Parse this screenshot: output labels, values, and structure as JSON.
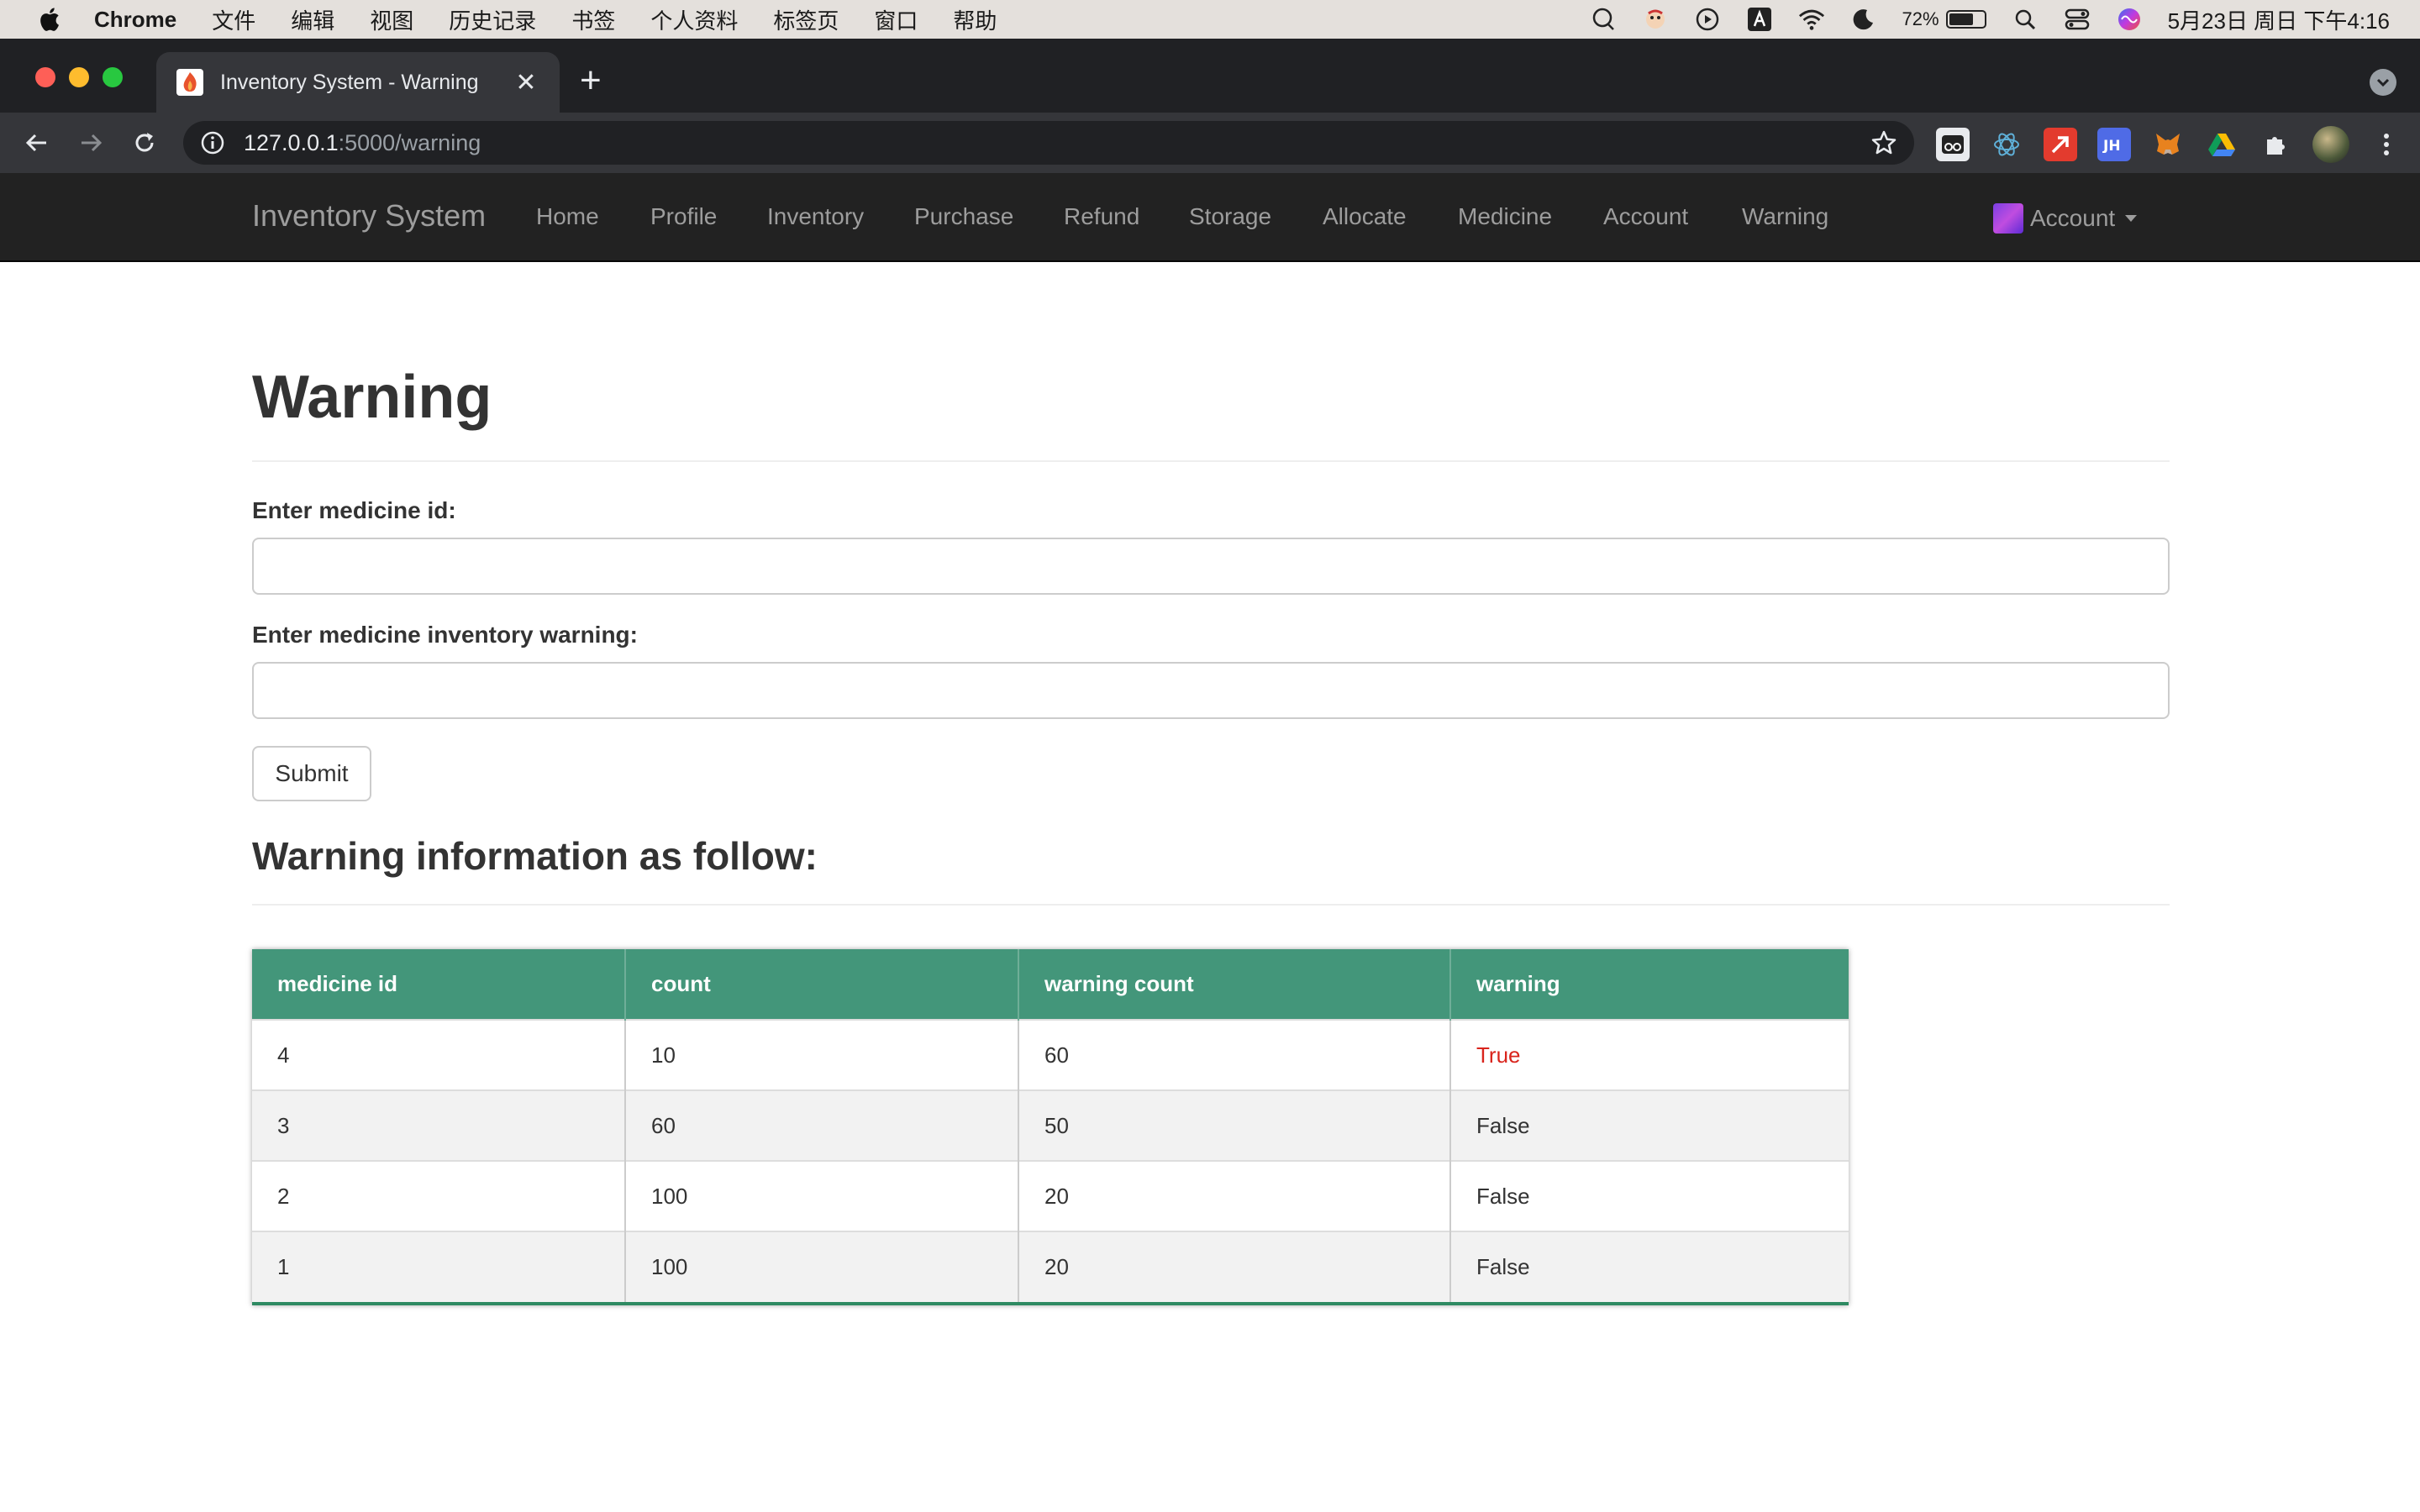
{
  "menubar": {
    "app_name": "Chrome",
    "items": [
      "文件",
      "编辑",
      "视图",
      "历史记录",
      "书签",
      "个人资料",
      "标签页",
      "窗口",
      "帮助"
    ],
    "battery": "72%",
    "battery_level": 0.72,
    "datetime": "5月23日 周日 下午4:16"
  },
  "browser": {
    "tab_title": "Inventory System - Warning",
    "url_host": "127.0.0.1",
    "url_path": ":5000/warning",
    "tab_close": "✕",
    "new_tab": "+"
  },
  "nav": {
    "brand": "Inventory System",
    "links": [
      "Home",
      "Profile",
      "Inventory",
      "Purchase",
      "Refund",
      "Storage",
      "Allocate",
      "Medicine",
      "Account",
      "Warning"
    ],
    "account_menu": "Account"
  },
  "page": {
    "title": "Warning",
    "medicine_id_label": "Enter medicine id:",
    "medicine_id_value": "",
    "warning_label": "Enter medicine inventory warning:",
    "warning_value": "",
    "submit_label": "Submit",
    "section_title": "Warning information as follow:"
  },
  "table": {
    "headers": [
      "medicine id",
      "count",
      "warning count",
      "warning"
    ],
    "rows": [
      [
        "4",
        "10",
        "60",
        "True"
      ],
      [
        "3",
        "60",
        "50",
        "False"
      ],
      [
        "2",
        "100",
        "20",
        "False"
      ],
      [
        "1",
        "100",
        "20",
        "False"
      ]
    ]
  },
  "colors": {
    "table_header": "#43967a",
    "warning_true": "#d9241c",
    "navbar": "#222222"
  }
}
